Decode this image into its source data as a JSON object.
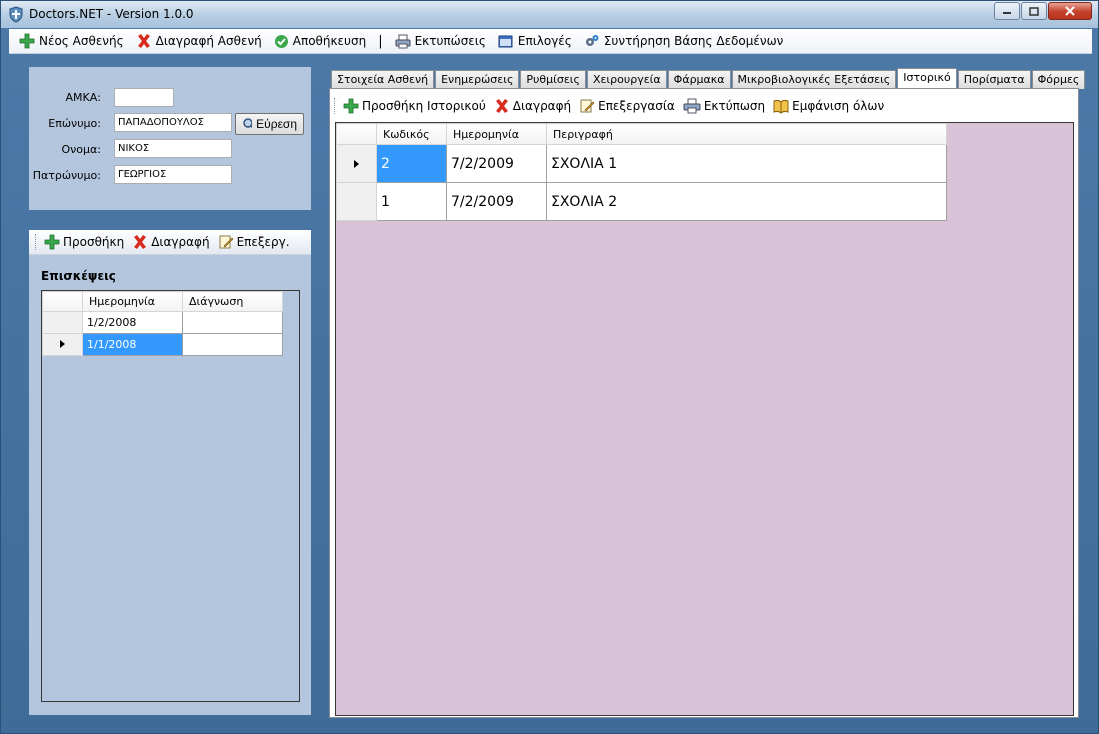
{
  "window": {
    "title": "Doctors.NET - Version 1.0.0"
  },
  "menu": {
    "new_patient": "Νέος Ασθενής",
    "delete_patient": "Διαγραφή Ασθενή",
    "save": "Αποθήκευση",
    "separator": "|",
    "prints": "Εκτυπώσεις",
    "options": "Επιλογές",
    "maintenance": "Συντήρηση Βάσης Δεδομένων"
  },
  "search": {
    "amka_label": "ΑΜΚΑ:",
    "amka_value": "",
    "surname_label": "Επώνυμο:",
    "surname_value": "ΠΑΠΑΔΟΠΟΥΛΟΣ",
    "name_label": "Ονομα:",
    "name_value": "ΝΙΚΟΣ",
    "father_label": "Πατρώνυμο:",
    "father_value": "ΓΕΩΡΓΙΟΣ",
    "find_button": "Εύρεση"
  },
  "left_toolbar": {
    "add": "Προσθήκη",
    "delete": "Διαγραφή",
    "edit": "Επεξεργ."
  },
  "visits": {
    "title": "Επισκέψεις",
    "columns": [
      "Ημερομηνία",
      "Διάγνωση"
    ],
    "rows": [
      {
        "date": "1/2/2008",
        "diagnosis": ""
      },
      {
        "date": "1/1/2008",
        "diagnosis": ""
      }
    ]
  },
  "tabs": [
    "Στοιχεία Ασθενή",
    "Ενημερώσεις",
    "Ρυθμίσεις",
    "Χειρουργεία",
    "Φάρμακα",
    "Μικροβιολογικές Εξετάσεις",
    "Ιστορικό",
    "Πορίσματα",
    "Φόρμες"
  ],
  "active_tab": "Ιστορικό",
  "history_toolbar": {
    "add": "Προσθήκη Ιστορικού",
    "delete": "Διαγραφή",
    "edit": "Επεξεργασία",
    "print": "Εκτύπωση",
    "show_all": "Εμφάνιση όλων"
  },
  "history": {
    "columns": [
      "Κωδικός",
      "Ημερομηνία",
      "Περιγραφή"
    ],
    "rows": [
      {
        "code": "2",
        "date": "7/2/2009",
        "description": "ΣΧΟΛΙΑ 1"
      },
      {
        "code": "1",
        "date": "7/2/2009",
        "description": "ΣΧΟΛΙΑ 2"
      }
    ]
  },
  "colors": {
    "selection": "#3399ff",
    "grid_background": "#d9c3d9",
    "panel_background": "#b4c6de"
  }
}
